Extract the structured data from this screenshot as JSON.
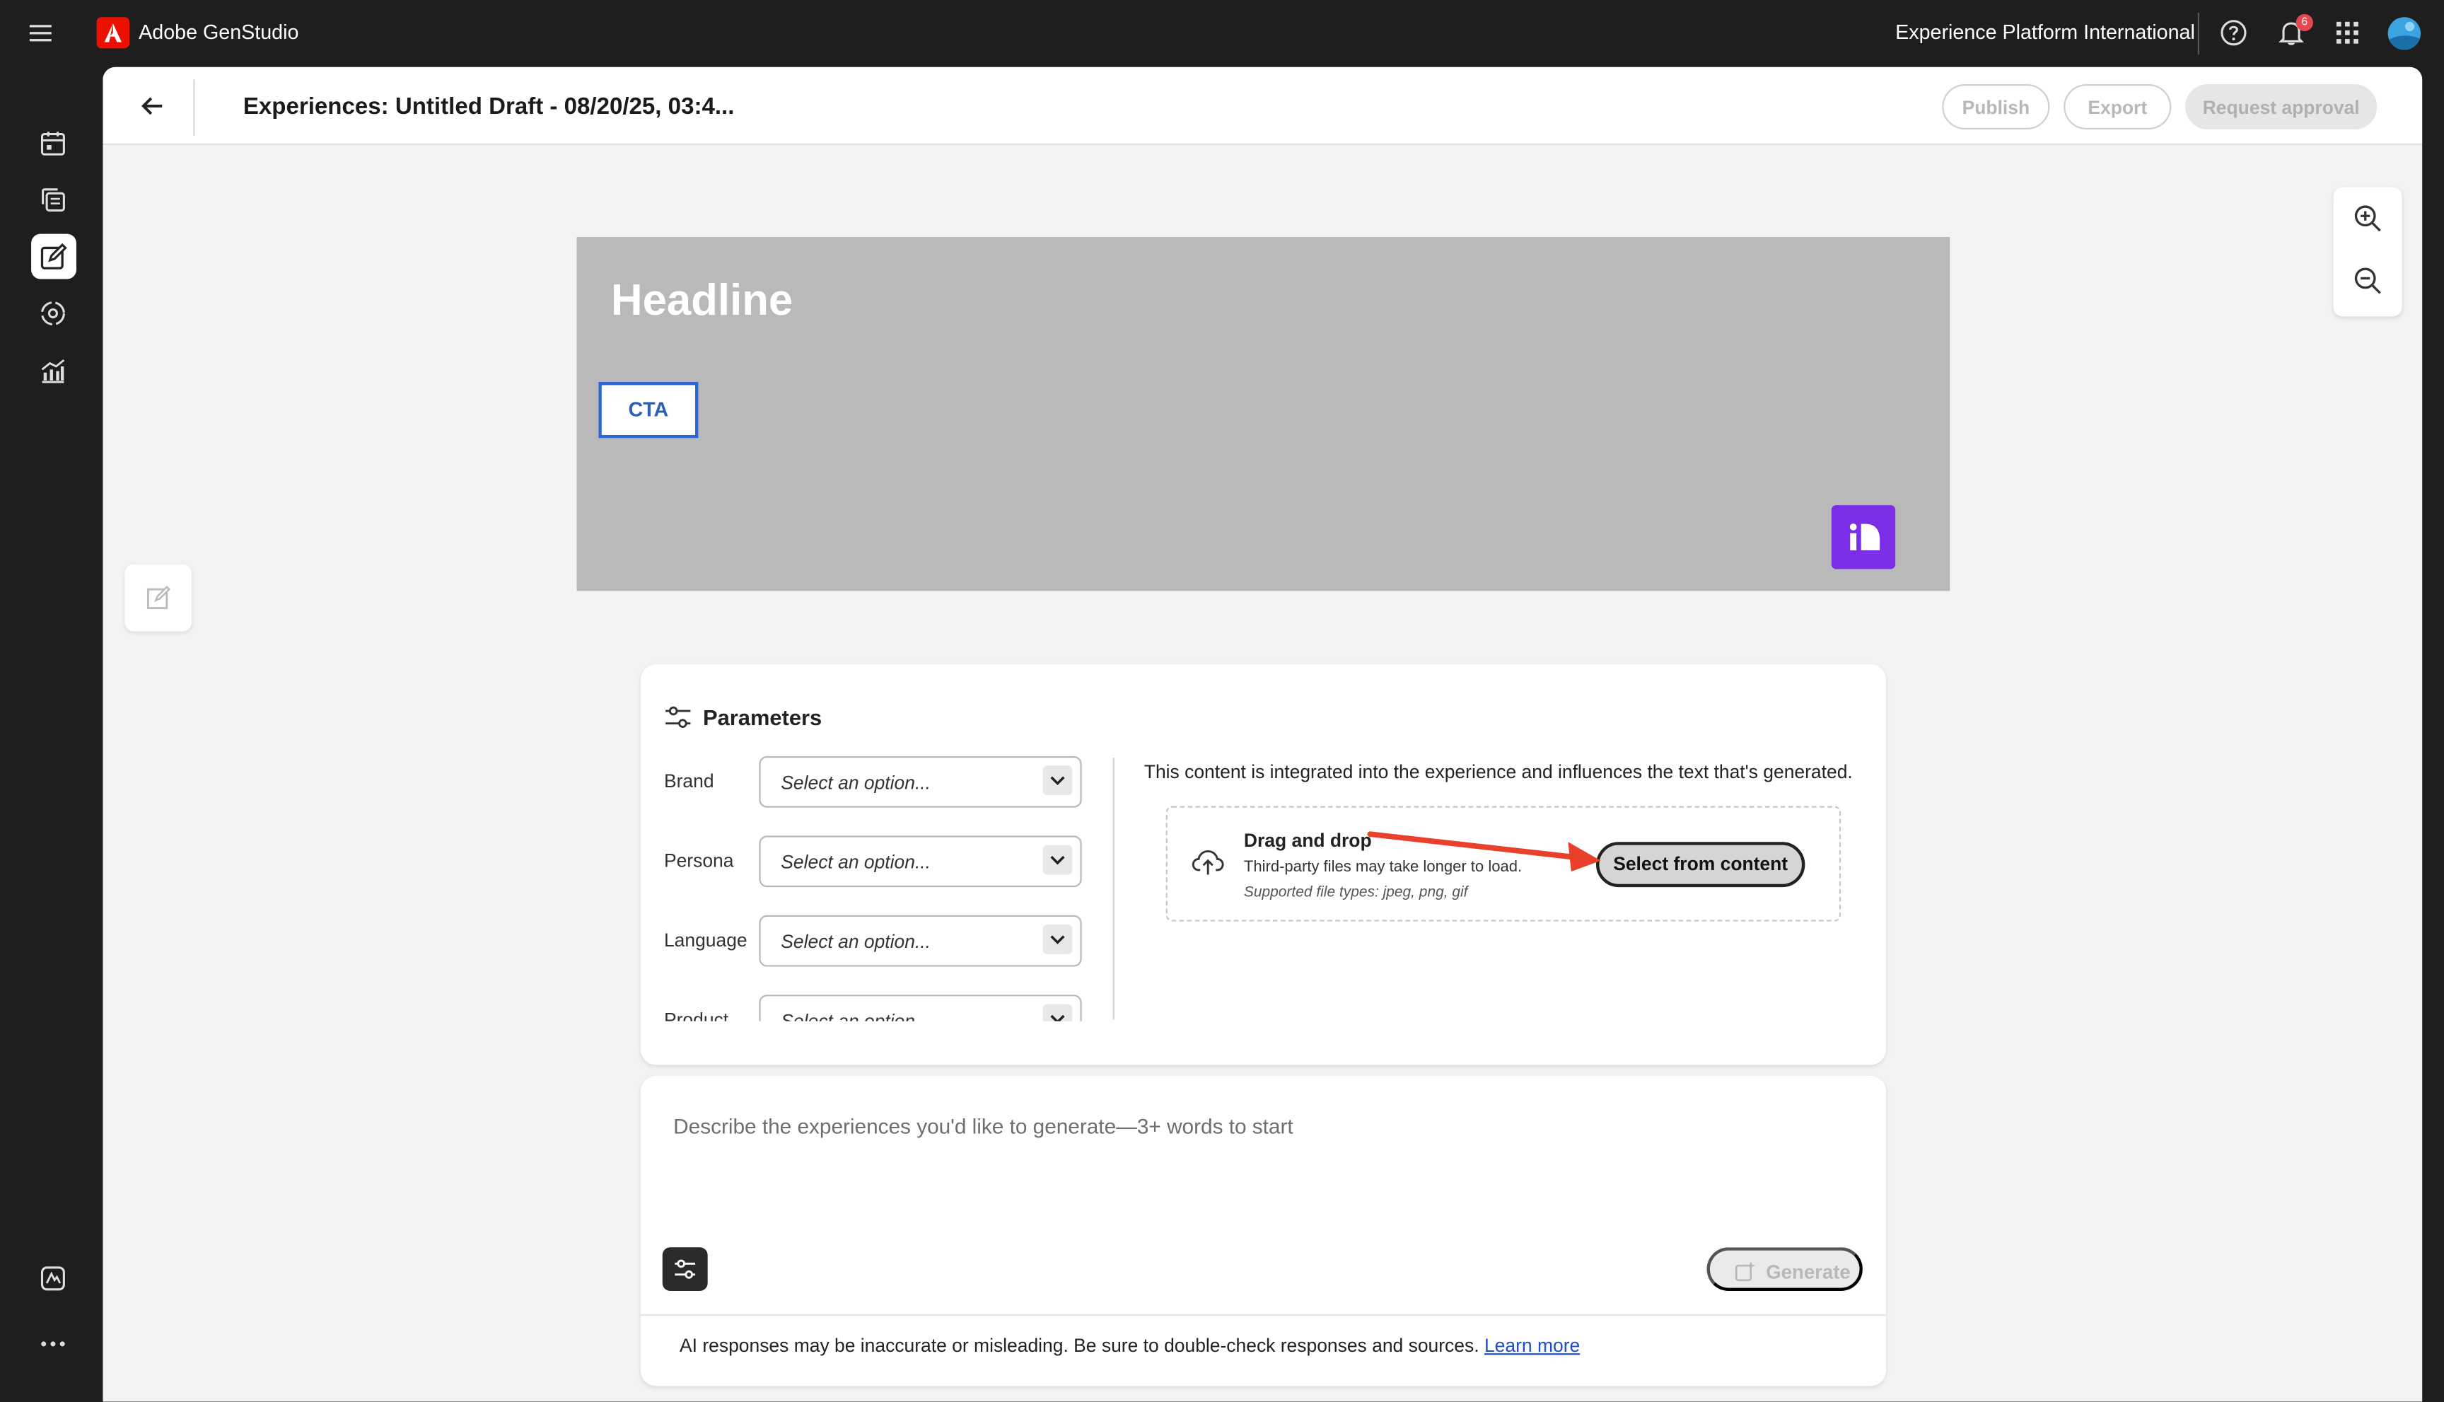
{
  "topbar": {
    "app_name": "Adobe GenStudio",
    "org_name": "Experience Platform International",
    "notification_count": "6",
    "icons": [
      "hamburger-icon",
      "adobe-logo",
      "help-icon",
      "bell-icon",
      "app-grid-icon",
      "avatar"
    ]
  },
  "rail": {
    "items": [
      "calendar-icon",
      "content-library-icon",
      "create-icon",
      "insights-target-icon",
      "analytics-icon"
    ],
    "active": "create-icon",
    "bottom_items": [
      "brand-icon",
      "more-icon"
    ]
  },
  "header": {
    "title": "Experiences: Untitled Draft - 08/20/25, 03:4...",
    "publish_label": "Publish",
    "export_label": "Export",
    "request_approval_label": "Request approval"
  },
  "canvas": {
    "headline": "Headline",
    "cta": "CTA",
    "background_color": "#b9b9b9",
    "logo_color": "#7b2ee6"
  },
  "parameters": {
    "title": "Parameters",
    "fields": [
      {
        "label": "Brand",
        "value": "Select an option..."
      },
      {
        "label": "Persona",
        "value": "Select an option..."
      },
      {
        "label": "Language",
        "value": "Select an option..."
      },
      {
        "label": "Product",
        "value": "Select an option..."
      }
    ],
    "context_text": "This content is integrated into the experience and influences the text that's generated.",
    "dropzone": {
      "title": "Drag and drop",
      "subtitle": "Third-party files may take longer to load.",
      "types": "Supported file types: jpeg, png, gif",
      "button_label": "Select from content"
    }
  },
  "prompt": {
    "placeholder": "Describe the experiences you'd like to generate—3+ words to start",
    "generate_label": "Generate",
    "disclaimer": "AI responses may be inaccurate or misleading. Be sure to double-check responses and sources.",
    "learn_more": "Learn more"
  },
  "colors": {
    "accent_annotation": "#e8402a",
    "cta_border": "#2c66d3",
    "notification_badge": "#e34850"
  }
}
